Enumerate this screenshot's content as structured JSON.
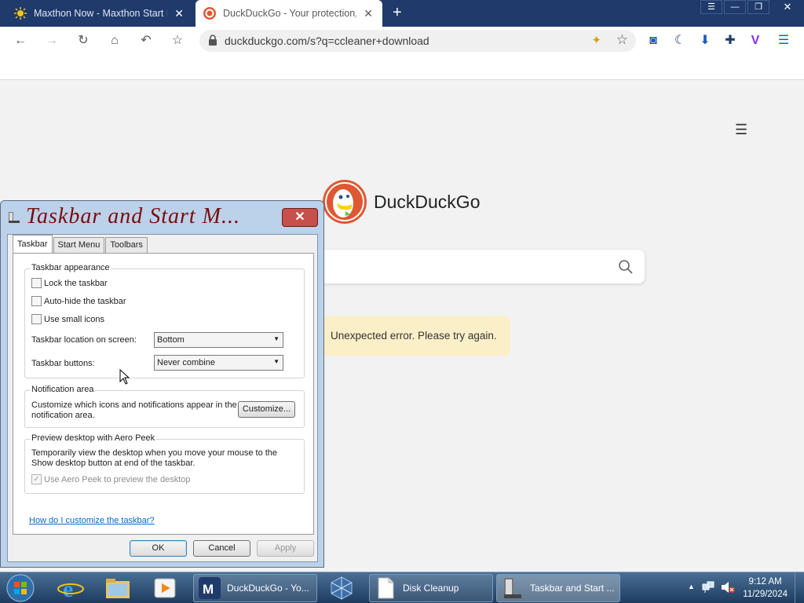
{
  "browser": {
    "tabs": [
      {
        "title": "Maxthon Now - Maxthon Start P",
        "active": false
      },
      {
        "title": "DuckDuckGo - Your protection, o",
        "active": true
      }
    ],
    "new_tab": "+",
    "close_glyph": "✕",
    "url": "duckduckgo.com/s?q=ccleaner+download",
    "nav_icons": [
      "back-icon",
      "forward-icon",
      "reload-icon",
      "home-icon",
      "undo-icon",
      "favorite-icon"
    ],
    "ext_icons": [
      "screenshot-icon",
      "night-mode-icon",
      "download-icon",
      "extensions-icon",
      "v-icon",
      "menu-icon"
    ]
  },
  "page": {
    "brand": "DuckDuckGo",
    "search_value": "",
    "error": "Unexpected error. Please try again.",
    "colors": {
      "error_bg": "#fbefc8",
      "ddg_orange": "#de5833"
    }
  },
  "dialog": {
    "title": "Taskbar and Start M...",
    "close": "✕",
    "tabs": [
      "Taskbar",
      "Start Menu",
      "Toolbars"
    ],
    "appearance": {
      "label": "Taskbar appearance",
      "lock": "Lock the taskbar",
      "autohide": "Auto-hide the taskbar",
      "small_icons": "Use small icons",
      "location_label": "Taskbar location on screen:",
      "location_value": "Bottom",
      "buttons_label": "Taskbar buttons:",
      "buttons_value": "Never combine"
    },
    "notification": {
      "label": "Notification area",
      "text": "Customize which icons and notifications appear in the notification area.",
      "button": "Customize..."
    },
    "aero": {
      "label": "Preview desktop with Aero Peek",
      "text": "Temporarily view the desktop when you move your mouse to the Show desktop button at end of the taskbar.",
      "checkbox": "Use Aero Peek to preview the desktop"
    },
    "link": "How do I customize the taskbar?",
    "ok": "OK",
    "cancel": "Cancel",
    "apply": "Apply"
  },
  "taskbar": {
    "tasks": [
      {
        "label": "DuckDuckGo - Yo..."
      },
      {
        "label": "Disk Cleanup"
      },
      {
        "label": "Taskbar and Start ..."
      }
    ],
    "time": "9:12 AM",
    "date": "11/29/2024"
  }
}
